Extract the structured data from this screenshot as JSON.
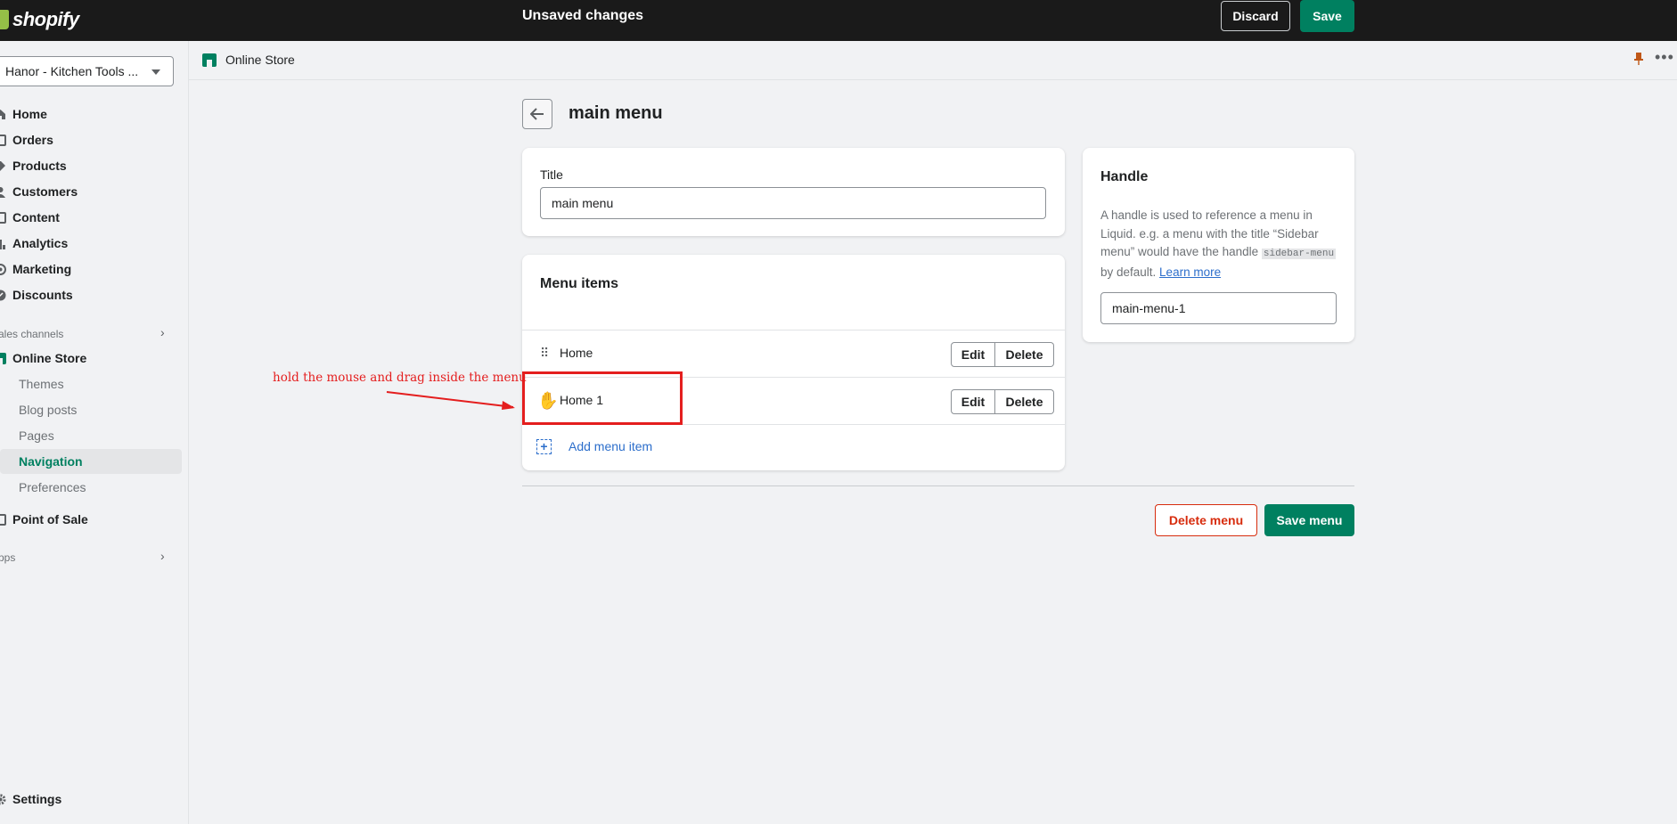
{
  "topbar": {
    "logo_text": "shopify",
    "status": "Unsaved changes",
    "discard_label": "Discard",
    "save_label": "Save"
  },
  "sidebar": {
    "store_name": "Hanor - Kitchen Tools ...",
    "items": [
      {
        "label": "Home",
        "icon": "home-icon"
      },
      {
        "label": "Orders",
        "icon": "orders-icon"
      },
      {
        "label": "Products",
        "icon": "tag-icon"
      },
      {
        "label": "Customers",
        "icon": "person-icon"
      },
      {
        "label": "Content",
        "icon": "content-icon"
      },
      {
        "label": "Analytics",
        "icon": "bar-chart-icon"
      },
      {
        "label": "Marketing",
        "icon": "target-icon"
      },
      {
        "label": "Discounts",
        "icon": "discount-icon"
      }
    ],
    "sales_channels_label": "ales channels",
    "online_store_label": "Online Store",
    "sub_items": [
      "Themes",
      "Blog posts",
      "Pages",
      "Navigation",
      "Preferences"
    ],
    "active_sub_item": "Navigation",
    "point_of_sale_label": "Point of Sale",
    "apps_label": "pps",
    "settings_label": "Settings"
  },
  "content_bar": {
    "title": "Online Store"
  },
  "page": {
    "title": "main menu",
    "title_field_label": "Title",
    "title_field_value": "main menu",
    "menu_items_heading": "Menu items",
    "menu_items": [
      {
        "label": "Home"
      },
      {
        "label": "Home 1"
      }
    ],
    "edit_label": "Edit",
    "delete_label": "Delete",
    "add_item_label": "Add menu item",
    "delete_menu_label": "Delete menu",
    "save_menu_label": "Save menu"
  },
  "handle": {
    "title": "Handle",
    "desc_before": "A handle is used to reference a menu in Liquid. e.g. a menu with the title “Sidebar menu” would have the handle ",
    "desc_code": "sidebar-menu",
    "desc_after": " by default. ",
    "learn_more": "Learn more",
    "value": "main-menu-1"
  },
  "annotation": {
    "text": "hold the mouse and drag inside the menu",
    "color": "#e41e1e"
  },
  "colors": {
    "brand_green": "#008060",
    "topbar_bg": "#1a1a1a",
    "link_blue": "#2c6ecb",
    "critical_red": "#d72c0d"
  }
}
